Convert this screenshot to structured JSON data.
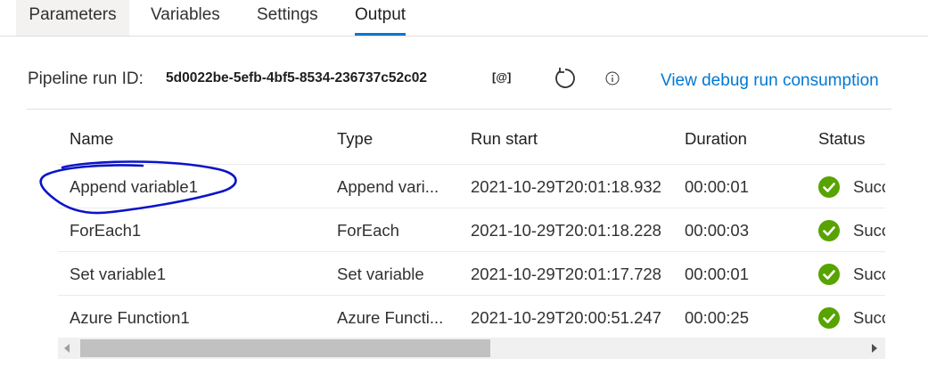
{
  "tabs": [
    {
      "label": "Parameters"
    },
    {
      "label": "Variables"
    },
    {
      "label": "Settings"
    },
    {
      "label": "Output"
    }
  ],
  "active_tab": "Output",
  "run": {
    "label": "Pipeline run ID:",
    "id": "5d0022be-5efb-4bf5-8534-236737c52c02",
    "copy_label": "[@]",
    "refresh_icon": "refresh-icon",
    "info_icon": "info-icon",
    "consumption_link": "View debug run consumption"
  },
  "table": {
    "headers": [
      "Name",
      "Type",
      "Run start",
      "Duration",
      "Status"
    ],
    "rows": [
      {
        "name": "Append variable1",
        "type": "Append vari...",
        "run_start": "2021-10-29T20:01:18.932",
        "duration": "00:00:01",
        "status": "Succ"
      },
      {
        "name": "ForEach1",
        "type": "ForEach",
        "run_start": "2021-10-29T20:01:18.228",
        "duration": "00:00:03",
        "status": "Succ"
      },
      {
        "name": "Set variable1",
        "type": "Set variable",
        "run_start": "2021-10-29T20:01:17.728",
        "duration": "00:00:01",
        "status": "Succ"
      },
      {
        "name": "Azure Function1",
        "type": "Azure Functi...",
        "run_start": "2021-10-29T20:00:51.247",
        "duration": "00:00:25",
        "status": "Succ"
      }
    ]
  },
  "colors": {
    "accent": "#0078d4",
    "success": "#57a300",
    "annotation": "#0a14c8"
  },
  "scroll": {
    "horizontal_position": 0.0
  }
}
